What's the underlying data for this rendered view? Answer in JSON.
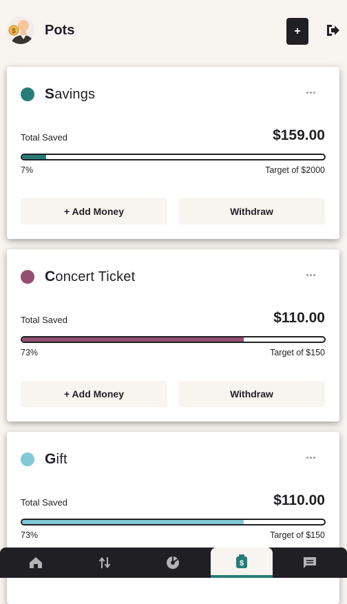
{
  "header": {
    "title": "Pots",
    "add_button_label": "+"
  },
  "pots": [
    {
      "name_first": "S",
      "name_rest": "avings",
      "color": "#277c78",
      "saved_label": "Total Saved",
      "amount": "$159.00",
      "percent_label": "7%",
      "progress": 0.0795,
      "target": "Target of $2000",
      "add_label": "+ Add Money",
      "withdraw_label": "Withdraw"
    },
    {
      "name_first": "C",
      "name_rest": "oncert Ticket",
      "color": "#934f6f",
      "saved_label": "Total Saved",
      "amount": "$110.00",
      "percent_label": "73%",
      "progress": 0.7333,
      "target": "Target of $150",
      "add_label": "+ Add Money",
      "withdraw_label": "Withdraw"
    },
    {
      "name_first": "G",
      "name_rest": "ift",
      "color": "#82c9d7",
      "saved_label": "Total Saved",
      "amount": "$110.00",
      "percent_label": "73%",
      "progress": 0.7333,
      "target": "Target of $150"
    }
  ],
  "nav": {
    "items": [
      {
        "icon": "home-icon"
      },
      {
        "icon": "transactions-icon"
      },
      {
        "icon": "budgets-icon"
      },
      {
        "icon": "pots-icon",
        "active": true
      },
      {
        "icon": "recurring-bills-icon"
      }
    ]
  },
  "colors": {
    "background": "#f8f4f0",
    "dark": "#201f24",
    "accent": "#277c78"
  }
}
